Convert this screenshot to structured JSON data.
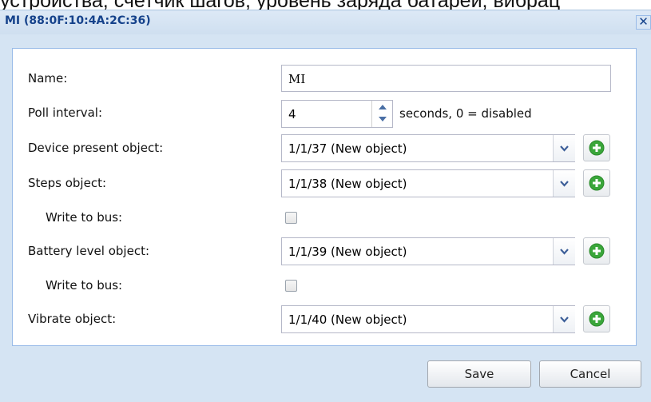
{
  "background": {
    "overflow_text": "устройства, счетчик шагов, уровень заряда батарей, вибрац"
  },
  "dialog": {
    "title": "MI (88:0F:10:4A:2C:36)",
    "close_glyph": "✕"
  },
  "form": {
    "name": {
      "label": "Name:",
      "value": "MI"
    },
    "poll": {
      "label": "Poll interval:",
      "value": "4",
      "hint": "seconds, 0 = disabled"
    },
    "device_present": {
      "label": "Device present object:",
      "value": "1/1/37 (New object)"
    },
    "steps": {
      "label": "Steps object:",
      "value": "1/1/38 (New object)"
    },
    "steps_write": {
      "label": "Write to bus:",
      "checked": false
    },
    "battery": {
      "label": "Battery level object:",
      "value": "1/1/39 (New object)"
    },
    "battery_write": {
      "label": "Write to bus:",
      "checked": false
    },
    "vibrate": {
      "label": "Vibrate object:",
      "value": "1/1/40 (New object)"
    }
  },
  "footer": {
    "save_label": "Save",
    "cancel_label": "Cancel"
  },
  "colors": {
    "title_text": "#15428b",
    "dialog_bg": "#d5e4f3",
    "add_icon_green": "#3aa63a"
  },
  "icons": {
    "close": "close-icon",
    "combo_arrow": "chevron-down-icon",
    "add": "plus-circle-icon",
    "spin": "spinner-arrows-icon"
  }
}
